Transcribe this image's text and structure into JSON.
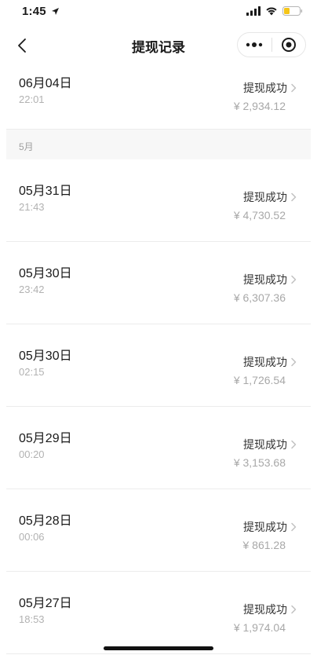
{
  "status_bar": {
    "time": "1:45"
  },
  "nav": {
    "title": "提现记录"
  },
  "records_top": [
    {
      "date": "06月04日",
      "time": "22:01",
      "status": "提现成功",
      "amount": "¥ 2,934.12"
    }
  ],
  "month": {
    "label": "5月"
  },
  "records": [
    {
      "date": "05月31日",
      "time": "21:43",
      "status": "提现成功",
      "amount": "¥ 4,730.52"
    },
    {
      "date": "05月30日",
      "time": "23:42",
      "status": "提现成功",
      "amount": "¥ 6,307.36"
    },
    {
      "date": "05月30日",
      "time": "02:15",
      "status": "提现成功",
      "amount": "¥ 1,726.54"
    },
    {
      "date": "05月29日",
      "time": "00:20",
      "status": "提现成功",
      "amount": "¥ 3,153.68"
    },
    {
      "date": "05月28日",
      "time": "00:06",
      "status": "提现成功",
      "amount": "¥ 861.28"
    },
    {
      "date": "05月27日",
      "time": "18:53",
      "status": "提现成功",
      "amount": "¥ 1,974.04"
    }
  ],
  "icons": {
    "back": "chevron-left-icon",
    "more": "more-dots-icon",
    "close": "target-circle-icon",
    "chevron": "chevron-right-icon"
  }
}
